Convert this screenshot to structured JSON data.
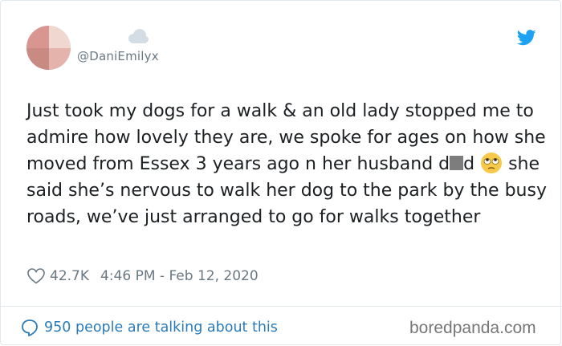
{
  "tweet": {
    "handle": "@DaniEmilyx",
    "text_part1": "Just took my dogs for a walk & an old lady stopped me to admire how lovely they are, we spoke for ages on how she moved from Essex 3 years ago n her husband d",
    "text_part2": "d",
    "text_part3": " she said she’s nervous to walk her dog to the park by the busy roads, we’ve just arranged to go for walks together",
    "likes": "42.7K",
    "timestamp": "4:46 PM - Feb 12, 2020"
  },
  "footer": {
    "talking": "950 people are talking about this",
    "watermark": "boredpanda.com"
  },
  "icons": {
    "avatar": "avatar-photo",
    "status": "cloud-icon",
    "brand": "twitter-bird-icon",
    "emoji": "eye-roll-emoji-icon",
    "like": "heart-icon",
    "reply": "comment-bubble-icon"
  },
  "colors": {
    "text": "#1c2022",
    "muted": "#697882",
    "link": "#2b7bb9",
    "twitter_blue": "#1da1f2",
    "redaction": "#7d7d7d"
  }
}
